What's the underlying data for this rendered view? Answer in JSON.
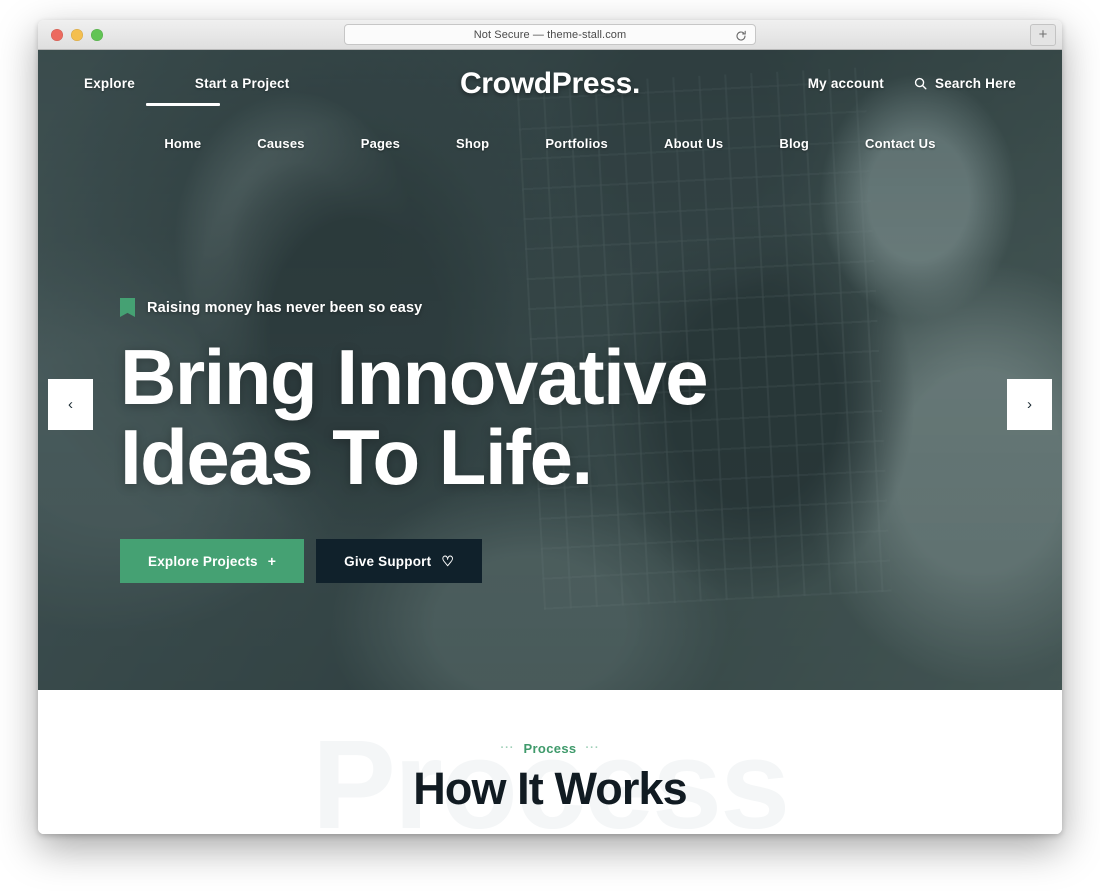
{
  "browser": {
    "address_bar": {
      "text": "Not Secure — theme-stall.com",
      "reload_icon": "reload-icon"
    },
    "traffic_lights": [
      "close",
      "minimize",
      "zoom"
    ],
    "new_tab_label": "+"
  },
  "site": {
    "brand": "CrowdPress.",
    "topbar": {
      "left_links": [
        {
          "label": "Explore"
        },
        {
          "label": "Start a Project"
        }
      ],
      "account_label": "My account",
      "search_label": "Search Here",
      "search_icon": "search-icon"
    },
    "mainnav": {
      "items": [
        {
          "label": "Home",
          "active": true
        },
        {
          "label": "Causes",
          "active": false
        },
        {
          "label": "Pages",
          "active": false
        },
        {
          "label": "Shop",
          "active": false
        },
        {
          "label": "Portfolios",
          "active": false
        },
        {
          "label": "About Us",
          "active": false
        },
        {
          "label": "Blog",
          "active": false
        },
        {
          "label": "Contact Us",
          "active": false
        }
      ]
    },
    "hero": {
      "eyebrow": "Raising money has never been so easy",
      "title_line1": "Bring Innovative",
      "title_line2": "Ideas To Life.",
      "primary_button": {
        "label": "Explore Projects",
        "glyph": "+"
      },
      "secondary_button": {
        "label": "Give Support",
        "glyph": "♡"
      },
      "prev_arrow": "‹",
      "next_arrow": "›"
    },
    "process": {
      "ghost_text": "Process",
      "label": "Process",
      "left_dots": "···",
      "right_dots": "···",
      "title": "How It Works"
    }
  },
  "colors": {
    "brand_green": "#45a173",
    "dark_navy": "#10212b",
    "label_green": "#3f9a6b",
    "ghost_gray": "#f4f6f7",
    "heading_dark": "#111b22"
  }
}
